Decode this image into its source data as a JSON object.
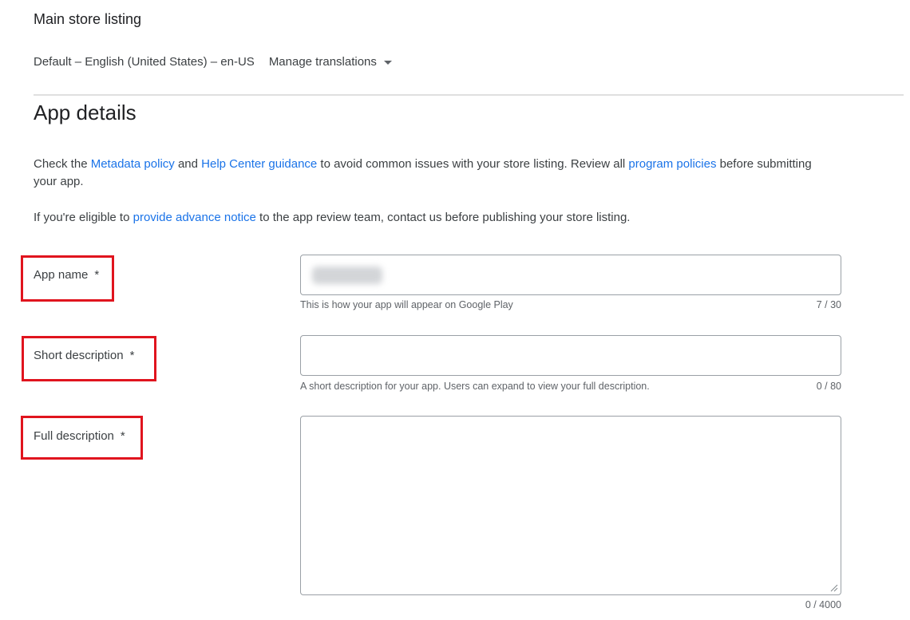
{
  "page": {
    "heading": "Main store listing",
    "language": "Default – English (United States) – en-US",
    "manage_translations": "Manage translations"
  },
  "section": {
    "title": "App details",
    "intro": {
      "t1": "Check the ",
      "link1": "Metadata policy",
      "t2": " and ",
      "link2": "Help Center guidance",
      "t3": " to avoid common issues with your store listing. Review all ",
      "link3": "program policies",
      "t4": " before submitting your app."
    },
    "notice": {
      "t1": "If you're eligible to ",
      "link": "provide advance notice",
      "t2": " to the app review team, contact us before publishing your store listing."
    }
  },
  "fields": {
    "app_name": {
      "label": "App name",
      "required_mark": "*",
      "helper": "This is how your app will appear on Google Play",
      "counter": "7 / 30"
    },
    "short_description": {
      "label": "Short description",
      "required_mark": "*",
      "helper": "A short description for your app. Users can expand to view your full description.",
      "counter": "0 / 80"
    },
    "full_description": {
      "label": "Full description",
      "required_mark": "*",
      "counter": "0 / 4000"
    }
  },
  "colors": {
    "link": "#1a73e8",
    "highlight_border": "#e0141e",
    "field_border": "#9aa0a6",
    "divider": "#e0e0e0"
  },
  "icons": {
    "manage_translations_caret": "chevron-down-icon",
    "textarea_resize": "resize-handle-icon"
  }
}
